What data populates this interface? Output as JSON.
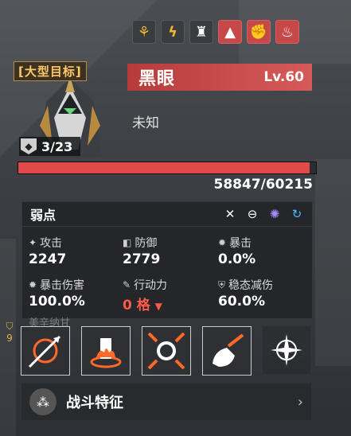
{
  "status_icons": [
    {
      "icon": "wheat-buff-icon",
      "style": "dark",
      "color": "#f2b632"
    },
    {
      "icon": "lightning-buff-icon",
      "style": "dark",
      "color": "#f2b632"
    },
    {
      "icon": "robot-buff-icon",
      "style": "dark",
      "color": "#ffffff"
    },
    {
      "icon": "boot-debuff-icon",
      "style": "red",
      "color": "#ffffff"
    },
    {
      "icon": "fist-debuff-icon",
      "style": "red",
      "color": "#ffffff"
    },
    {
      "icon": "fire-debuff-icon",
      "style": "red",
      "color": "#ffffff"
    }
  ],
  "target_tag": "[大型目标]",
  "unit_count": "3/23",
  "enemy": {
    "name": "黑眼",
    "level": "Lv.60",
    "faction": "未知"
  },
  "hp": {
    "current": 58847,
    "max": 60215,
    "text": "58847/60215"
  },
  "weakness": {
    "label": "弱点",
    "icons": [
      "cross-slash-icon",
      "target-crosshair-icon",
      "purple-orb-icon",
      "blue-swirl-icon"
    ]
  },
  "stats": [
    {
      "icon": "attack-icon",
      "label": "攻击",
      "value": "2247"
    },
    {
      "icon": "shield-icon",
      "label": "防御",
      "value": "2779"
    },
    {
      "icon": "crit-icon",
      "label": "暴击",
      "value": "0.0%"
    },
    {
      "icon": "crit-dmg-icon",
      "label": "暴击伤害",
      "value": "100.0%"
    },
    {
      "icon": "action-icon",
      "label": "行动力",
      "value": "0 格",
      "marker": "▼"
    },
    {
      "icon": "stability-icon",
      "label": "稳态减伤",
      "value": "60.0%"
    }
  ],
  "faded_text": "美辛纳甘",
  "side_marker": "9",
  "skills": [
    "spear-strike-icon",
    "flame-armor-icon",
    "burst-core-icon",
    "drill-icon",
    "compass-star-icon"
  ],
  "feature_label": "战斗特征",
  "colors": {
    "accent_red": "#d75a5a",
    "hp_fill": "#e04a4a",
    "gold": "#ffc86b"
  }
}
